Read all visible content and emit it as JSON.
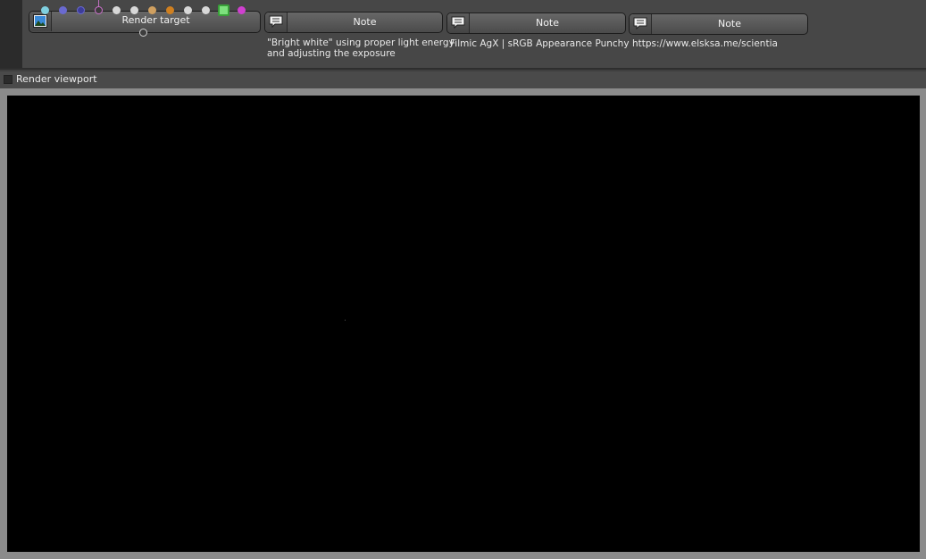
{
  "render_target": {
    "label": "Render target",
    "pin_colors": [
      "#7fd0e0",
      "#6a6ad0",
      "#3d3d9a",
      "#d070d0",
      "#d8d8d8",
      "#d8d8d8",
      "#d0a060",
      "#d08020",
      "#d8d8d8",
      "#d8d8d8",
      "#7de07d",
      "#d040d0"
    ]
  },
  "notes": [
    {
      "label": "Note",
      "text": "\"Bright white\" using proper light energy\nand adjusting the exposure"
    },
    {
      "label": "Note",
      "text": "Filmic AgX | sRGB Appearance Punchy"
    },
    {
      "label": "Note",
      "text": "https://www.elsksa.me/scientia"
    }
  ],
  "viewport": {
    "label": "Render viewport"
  }
}
